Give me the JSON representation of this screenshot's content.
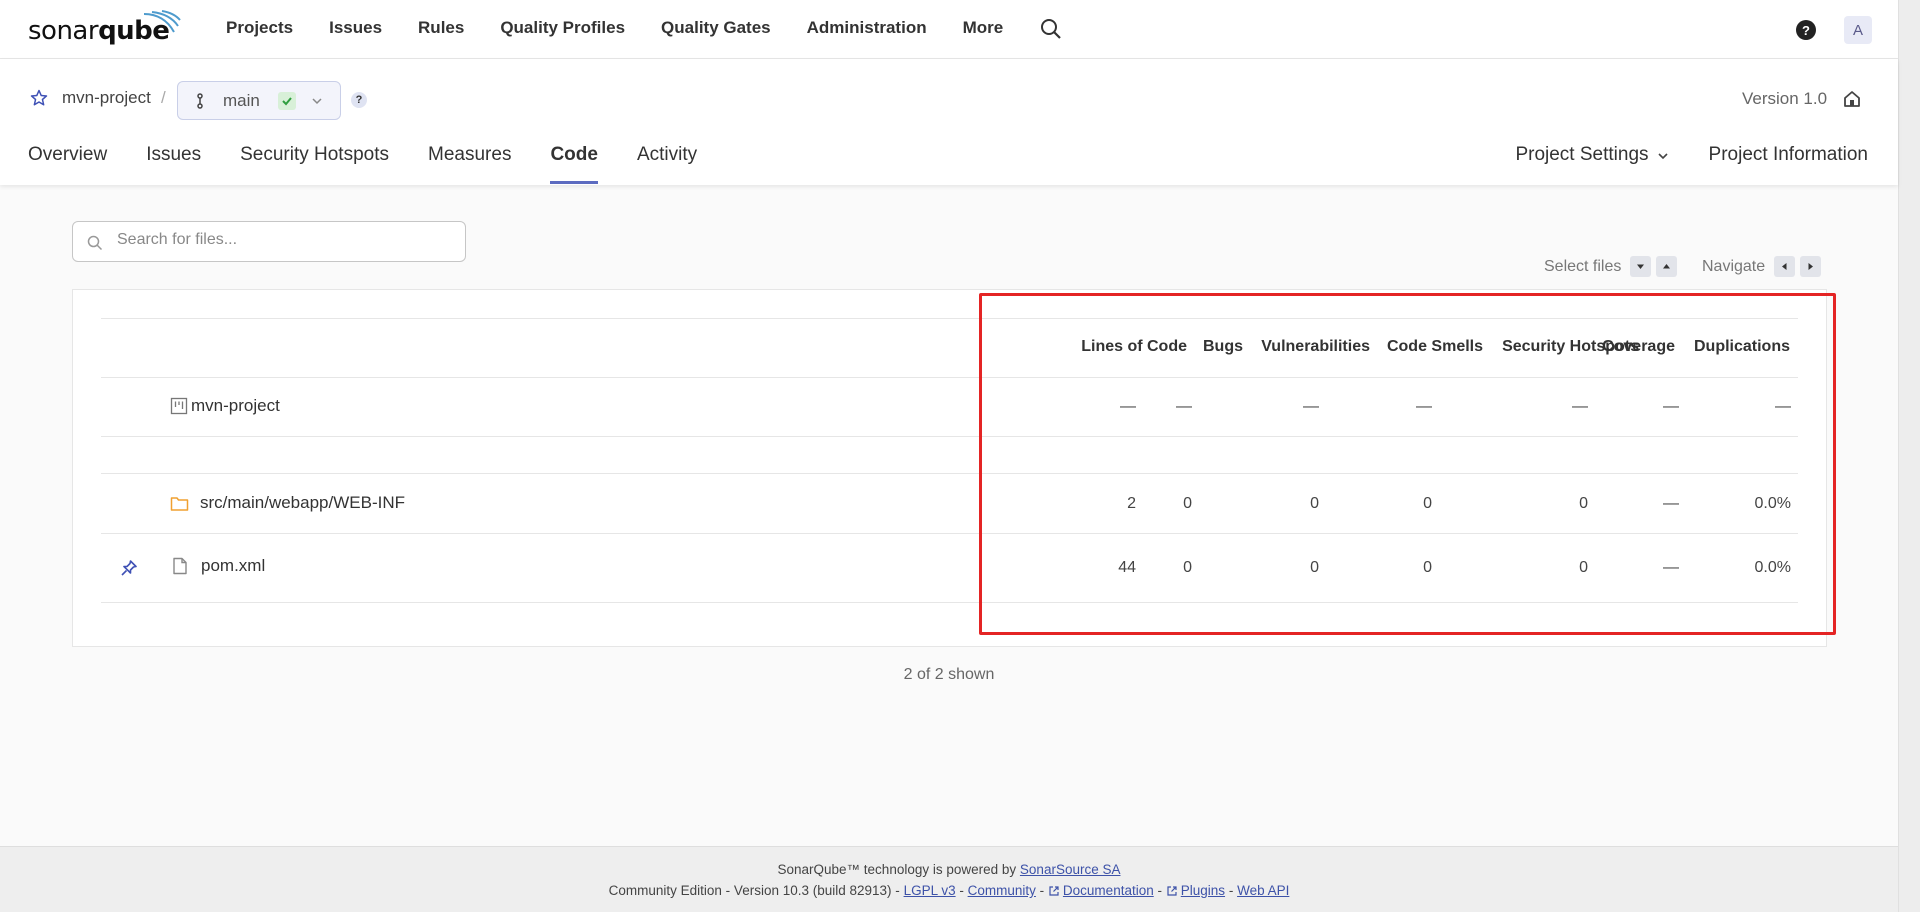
{
  "brand": {
    "logo_plain": "sonar",
    "logo_bold": "qube"
  },
  "nav": {
    "items": [
      "Projects",
      "Issues",
      "Rules",
      "Quality Profiles",
      "Quality Gates",
      "Administration",
      "More"
    ],
    "help": "?",
    "avatar_initial": "A"
  },
  "project": {
    "name": "mvn-project",
    "separator": "/",
    "branch": "main",
    "help": "?",
    "version": "Version 1.0"
  },
  "tabs": [
    "Overview",
    "Issues",
    "Security Hotspots",
    "Measures",
    "Code",
    "Activity"
  ],
  "right_tabs": {
    "settings": "Project Settings",
    "info": "Project Information"
  },
  "search": {
    "placeholder": "Search for files..."
  },
  "keyboard": {
    "select": "Select files",
    "navigate": "Navigate"
  },
  "table": {
    "headers": [
      "Lines of Code",
      "Bugs",
      "Vulnerabilities",
      "Code Smells",
      "Security Hotspots",
      "Coverage",
      "Duplications"
    ],
    "root": {
      "name": "mvn-project",
      "values": [
        "—",
        "—",
        "—",
        "—",
        "—",
        "—",
        "—"
      ]
    },
    "rows": [
      {
        "name": "src/main/webapp/WEB-INF",
        "icon": "folder-icon",
        "values": [
          "2",
          "0",
          "0",
          "0",
          "0",
          "—",
          "0.0%"
        ]
      },
      {
        "name": "pom.xml",
        "icon": "file-icon",
        "values": [
          "44",
          "0",
          "0",
          "0",
          "0",
          "—",
          "0.0%"
        ]
      }
    ]
  },
  "shown": "2 of 2 shown",
  "footer": {
    "line1_prefix": "SonarQube™ technology is powered by",
    "line1_link": "SonarSource SA",
    "edition": "Community Edition - Version 10.3 (build 82913) -",
    "links": [
      "LGPL v3",
      "Community",
      "Documentation",
      "Plugins",
      "Web API"
    ],
    "dash": "-"
  },
  "colors": {
    "accent": "#5c6bc0",
    "highlight": "#e42424",
    "folder": "#f0a030"
  }
}
